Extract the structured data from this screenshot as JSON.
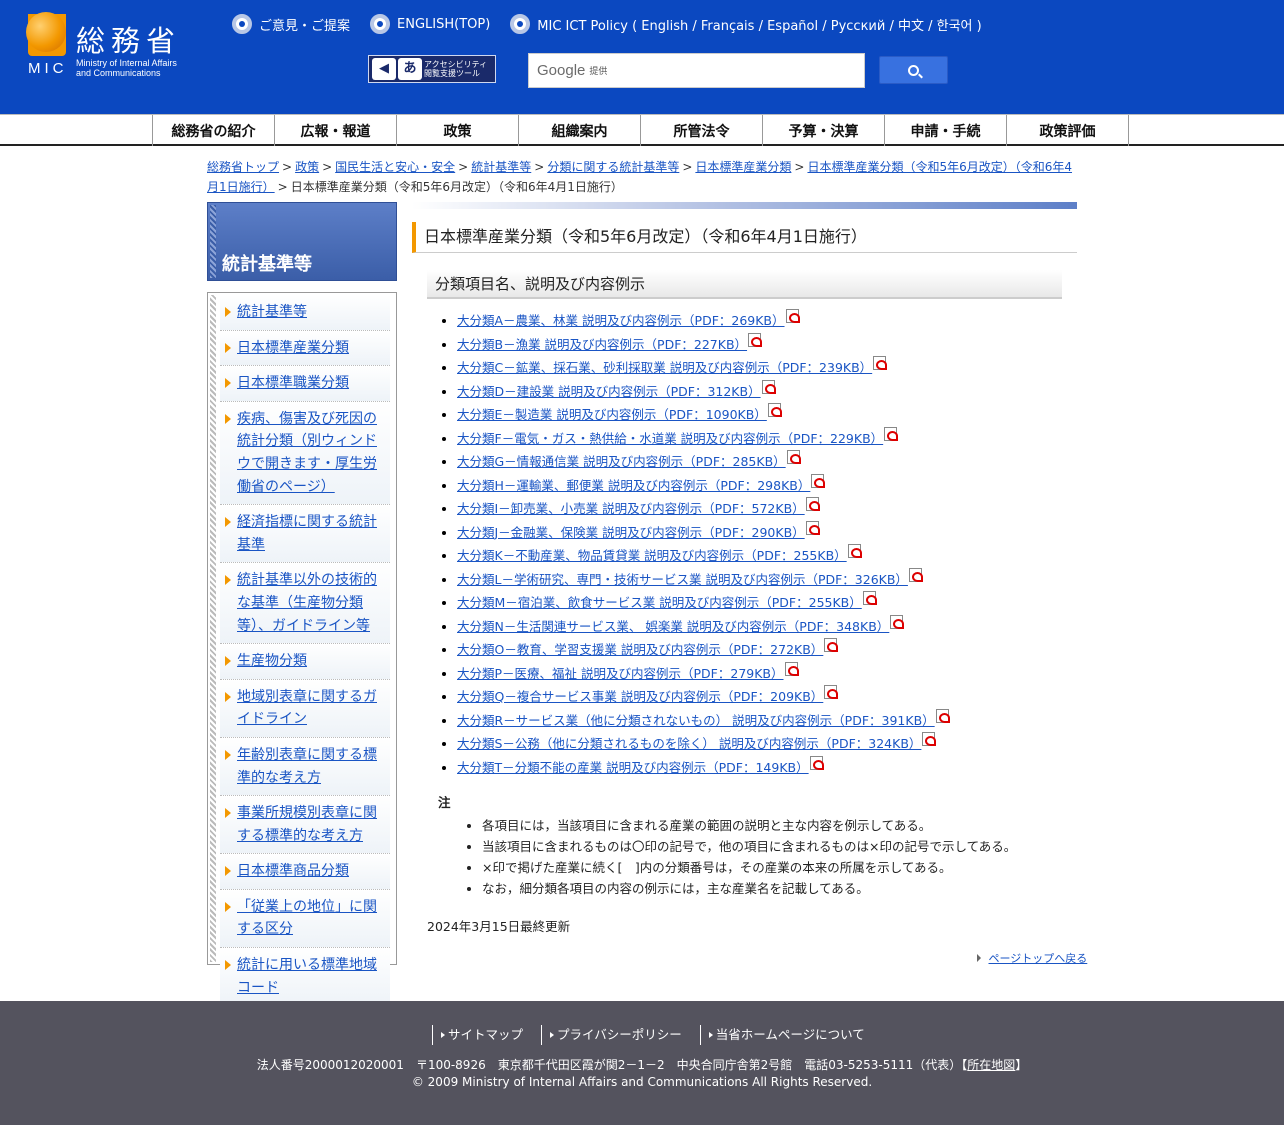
{
  "header": {
    "logo_kanji": "総務省",
    "logo_mic": "MIC",
    "logo_sub_1": "Ministry of Internal Affairs",
    "logo_sub_2": "and Communications",
    "top_links": [
      "ご意見・ご提案",
      "ENGLISH(TOP)",
      "MIC ICT Policy ( English / Français / Español / Русский / 中文 / 한국어 )"
    ],
    "a11y_text_1": "アクセシビリティ",
    "a11y_text_2": "閲覧支援ツール",
    "search_brand": "Google",
    "search_sub": "提供"
  },
  "gnav": [
    "総務省の紹介",
    "広報・報道",
    "政策",
    "組織案内",
    "所管法令",
    "予算・決算",
    "申請・手続",
    "政策評価"
  ],
  "breadcrumb": {
    "links": [
      "総務省トップ",
      "政策",
      "国民生活と安心・安全",
      "統計基準等",
      "分類に関する統計基準等",
      "日本標準産業分類",
      "日本標準産業分類（令和5年6月改定）（令和6年4月1日施行）"
    ],
    "current": "日本標準産業分類（令和5年6月改定）（令和6年4月1日施行）",
    "separator": ">"
  },
  "sidebar": {
    "title": "統計基準等",
    "items": [
      "統計基準等",
      "日本標準産業分類",
      "日本標準職業分類",
      "疾病、傷害及び死因の統計分類（別ウィンドウで開きます・厚生労働省のページ）",
      "経済指標に関する統計基準",
      "統計基準以外の技術的な基準（生産物分類等）、ガイドライン等",
      "生産物分類",
      "地域別表章に関するガイドライン",
      "年齢別表章に関する標準的な考え方",
      "事業所規模別表章に関する標準的な考え方",
      "日本標準商品分類",
      "「従業上の地位」に関する区分",
      "統計に用いる標準地域コード"
    ]
  },
  "main": {
    "title": "日本標準産業分類（令和5年6月改定）（令和6年4月1日施行）",
    "section_heading": "分類項目名、説明及び内容例示",
    "pdf_links": [
      "大分類A－農業、林業 説明及び内容例示（PDF：269KB）",
      "大分類B－漁業 説明及び内容例示（PDF：227KB）",
      "大分類C－鉱業、採石業、砂利採取業 説明及び内容例示（PDF：239KB）",
      "大分類D－建設業 説明及び内容例示（PDF：312KB）",
      "大分類E－製造業 説明及び内容例示（PDF：1090KB）",
      "大分類F－電気・ガス・熱供給・水道業 説明及び内容例示（PDF：229KB）",
      "大分類G－情報通信業 説明及び内容例示（PDF：285KB）",
      "大分類H－運輸業、郵便業 説明及び内容例示（PDF：298KB）",
      "大分類I－卸売業、小売業 説明及び内容例示（PDF：572KB）",
      "大分類J－金融業、保険業 説明及び内容例示（PDF：290KB）",
      "大分類K－不動産業、物品賃貸業 説明及び内容例示（PDF：255KB）",
      "大分類L－学術研究、専門・技術サービス業 説明及び内容例示（PDF：326KB）",
      "大分類M－宿泊業、飲食サービス業 説明及び内容例示（PDF：255KB）",
      "大分類N－生活関連サービス業、 娯楽業 説明及び内容例示（PDF：348KB）",
      "大分類O－教育、学習支援業 説明及び内容例示（PDF：272KB）",
      "大分類P－医療、福祉 説明及び内容例示（PDF：279KB）",
      "大分類Q－複合サービス事業 説明及び内容例示（PDF：209KB）",
      "大分類R－サービス業（他に分類されないもの） 説明及び内容例示（PDF：391KB）",
      "大分類S－公務（他に分類されるものを除く） 説明及び内容例示（PDF：324KB）",
      "大分類T－分類不能の産業 説明及び内容例示（PDF：149KB）"
    ],
    "note_title": "注",
    "notes": [
      "各項目には，当該項目に含まれる産業の範囲の説明と主な内容を例示してある。",
      "当該項目に含まれるものは〇印の記号で，他の項目に含まれるものは×印の記号で示してある。",
      "×印で掲げた産業に続く[　]内の分類番号は，その産業の本来の所属を示してある。",
      "なお，細分類各項目の内容の例示には，主な産業名を記載してある。"
    ],
    "updated": "2024年3月15日最終更新",
    "page_top": "ページトップへ戻る"
  },
  "footer": {
    "links": [
      "サイトマップ",
      "プライバシーポリシー",
      "当省ホームページについて"
    ],
    "address": "法人番号2000012020001　〒100-8926　東京都千代田区霞が関2－1－2　中央合同庁舎第2号館　電話03-5253-5111（代表）",
    "map_open": "【",
    "map_link": "所在地図",
    "map_close": "】",
    "copyright": "© 2009 Ministry of Internal Affairs and Communications All Rights Reserved."
  },
  "colors": {
    "header_bg": "#0b48c0",
    "accent_orange": "#f39800",
    "link": "#1a55c4",
    "footer_bg": "#54535e"
  }
}
